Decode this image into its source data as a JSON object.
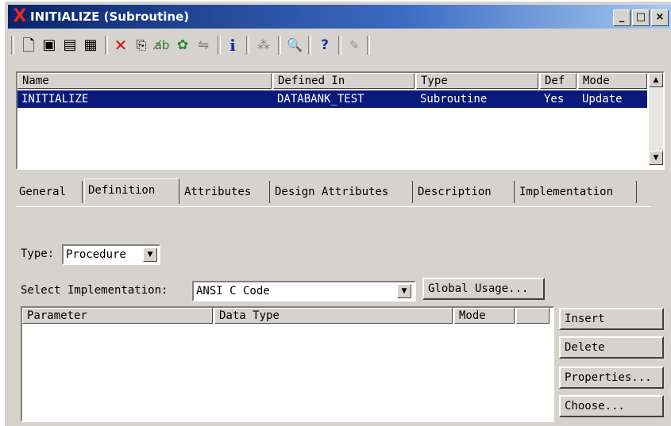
{
  "window": {
    "title": "INITIALIZE (Subroutine)",
    "minimize": "_",
    "maximize": "□",
    "close": "×"
  },
  "toolbar": {
    "icons": [
      "new-icon",
      "save-icon",
      "save-as-icon",
      "print-icon",
      "delete-icon",
      "copy-icon",
      "rename-icon",
      "relations-icon",
      "compare-icon",
      "info-icon",
      "tree-icon",
      "find-icon",
      "help-icon",
      "edit-icon"
    ]
  },
  "grid": {
    "columns": [
      "Name",
      "Defined In",
      "Type",
      "Def",
      "Mode"
    ],
    "rows": [
      {
        "name": "INITIALIZE",
        "defined_in": "DATABANK_TEST",
        "type": "Subroutine",
        "def": "Yes",
        "mode": "Update"
      }
    ]
  },
  "tabs": [
    "General",
    "Definition",
    "Attributes",
    "Design Attributes",
    "Description",
    "Implementation"
  ],
  "active_tab": "Definition",
  "definition": {
    "type_label": "Type:",
    "type_value": "Procedure",
    "impl_label": "Select Implementation:",
    "impl_value": "ANSI C Code",
    "global_usage": "Global Usage...",
    "param_columns": [
      "Parameter",
      "Data Type",
      "Mode"
    ],
    "buttons": [
      "Insert",
      "Delete",
      "Properties...",
      "Choose..."
    ]
  }
}
